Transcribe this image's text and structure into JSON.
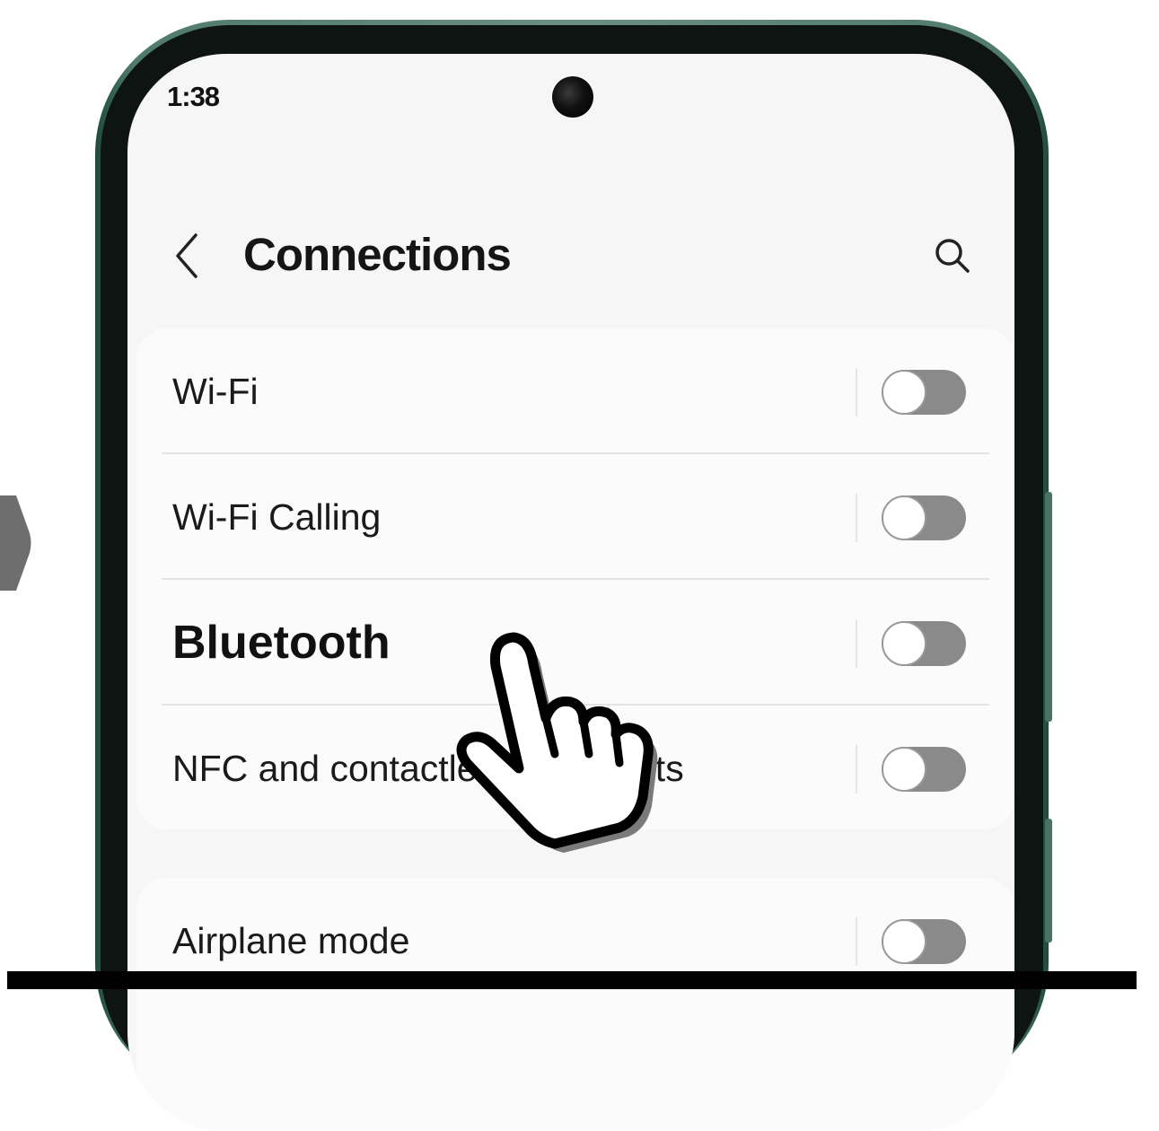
{
  "status_bar": {
    "time": "1:38"
  },
  "header": {
    "title": "Connections",
    "back_icon": "chevron-left-icon",
    "search_icon": "search-icon"
  },
  "connections_group": {
    "items": [
      {
        "label": "Wi-Fi",
        "enabled": false
      },
      {
        "label": "Wi-Fi Calling",
        "enabled": false
      },
      {
        "label": "Bluetooth",
        "enabled": false,
        "highlighted": true
      },
      {
        "label": "NFC and contactless payments",
        "enabled": false
      }
    ]
  },
  "airplane_group": {
    "items": [
      {
        "label": "Airplane mode",
        "enabled": false
      }
    ]
  },
  "overlay": {
    "cursor_icon": "pointing-hand-icon",
    "prev_arrow_icon": "chevron-right-icon"
  },
  "colors": {
    "frame": "#4f7a6c",
    "screen_bg": "#f6f6f6",
    "card_bg": "#fbfbfb",
    "toggle_off": "#8a8a8a"
  }
}
